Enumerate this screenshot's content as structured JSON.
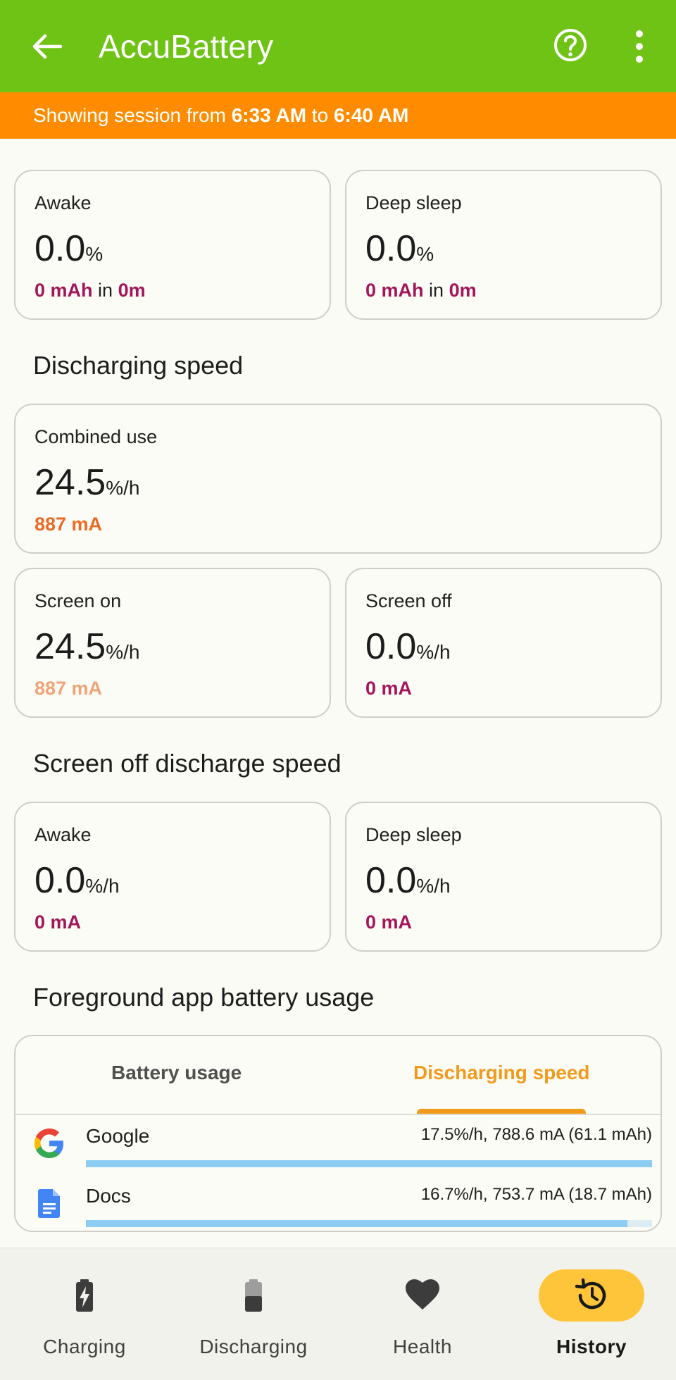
{
  "appbar": {
    "title": "AccuBattery"
  },
  "session": {
    "prefix": "Showing session from ",
    "start": "6:33 AM",
    "mid": " to ",
    "end": "6:40 AM"
  },
  "top_cards": [
    {
      "label": "Awake",
      "value": "0.0",
      "unit": "%",
      "mah": "0 mAh",
      "in": " in ",
      "time": "0m"
    },
    {
      "label": "Deep sleep",
      "value": "0.0",
      "unit": "%",
      "mah": "0 mAh",
      "in": " in ",
      "time": "0m"
    }
  ],
  "discharging_speed": {
    "heading": "Discharging speed",
    "combined": {
      "label": "Combined use",
      "value": "24.5",
      "unit": "%/h",
      "current": "887 mA"
    },
    "screen_on": {
      "label": "Screen on",
      "value": "24.5",
      "unit": "%/h",
      "current": "887 mA"
    },
    "screen_off": {
      "label": "Screen off",
      "value": "0.0",
      "unit": "%/h",
      "current": "0 mA"
    }
  },
  "screen_off_speed": {
    "heading": "Screen off discharge speed",
    "awake": {
      "label": "Awake",
      "value": "0.0",
      "unit": "%/h",
      "current": "0 mA"
    },
    "deep_sleep": {
      "label": "Deep sleep",
      "value": "0.0",
      "unit": "%/h",
      "current": "0 mA"
    }
  },
  "foreground": {
    "heading": "Foreground app battery usage",
    "tabs": {
      "usage": "Battery usage",
      "speed": "Discharging speed"
    },
    "apps": [
      {
        "name": "Google",
        "stats": "17.5%/h, 788.6 mA (61.1 mAh)",
        "fraction": 1.0
      },
      {
        "name": "Docs",
        "stats": "16.7%/h, 753.7 mA (18.7 mAh)",
        "fraction": 0.956
      }
    ]
  },
  "bottom_nav": {
    "charging": "Charging",
    "discharging": "Discharging",
    "health": "Health",
    "history": "History"
  },
  "colors": {
    "appbar": "#6fc315",
    "session_banner": "#ff8c00",
    "accent_magenta": "#a3165a",
    "accent_orange": "#ec6a27",
    "active_tab": "#f29a1d",
    "active_nav": "#fec53a"
  }
}
